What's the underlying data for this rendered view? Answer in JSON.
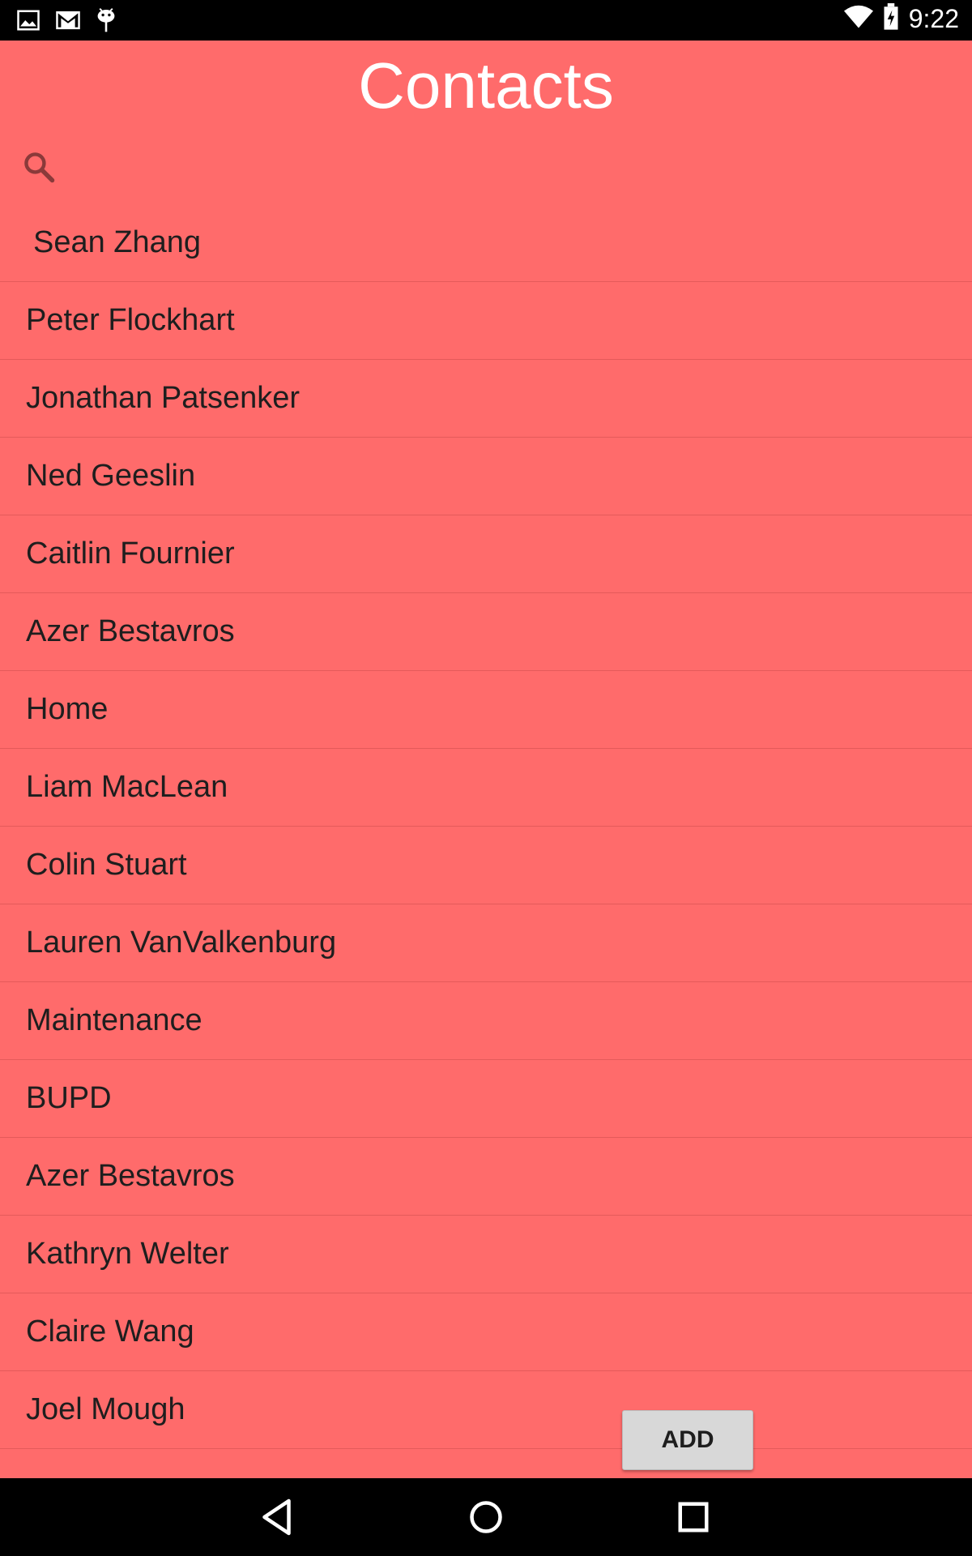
{
  "status_bar": {
    "time": "9:22",
    "left_icons": [
      "image-icon",
      "gmail-icon",
      "android-debug-icon"
    ],
    "right_icons": [
      "wifi-icon",
      "battery-charging-icon"
    ]
  },
  "header": {
    "title": "Contacts"
  },
  "search": {
    "icon": "search-icon",
    "value": "",
    "placeholder": ""
  },
  "contacts": [
    {
      "name": "Sean Zhang"
    },
    {
      "name": "Peter Flockhart"
    },
    {
      "name": "Jonathan Patsenker"
    },
    {
      "name": "Ned Geeslin"
    },
    {
      "name": "Caitlin Fournier"
    },
    {
      "name": "Azer Bestavros"
    },
    {
      "name": "Home"
    },
    {
      "name": "Liam MacLean"
    },
    {
      "name": "Colin Stuart"
    },
    {
      "name": "Lauren VanValkenburg"
    },
    {
      "name": "Maintenance"
    },
    {
      "name": "BUPD"
    },
    {
      "name": "Azer Bestavros"
    },
    {
      "name": "Kathryn Welter"
    },
    {
      "name": "Claire Wang"
    },
    {
      "name": "Joel Mough"
    }
  ],
  "actions": {
    "add_label": "ADD"
  },
  "nav_bar": {
    "buttons": [
      "back-icon",
      "home-icon",
      "recents-icon"
    ]
  },
  "colors": {
    "background": "#ff6b6b",
    "title_text": "#ffffff",
    "row_text": "#1e1e1e",
    "divider": "#e45a5a",
    "button_bg": "#d8d8d8"
  }
}
